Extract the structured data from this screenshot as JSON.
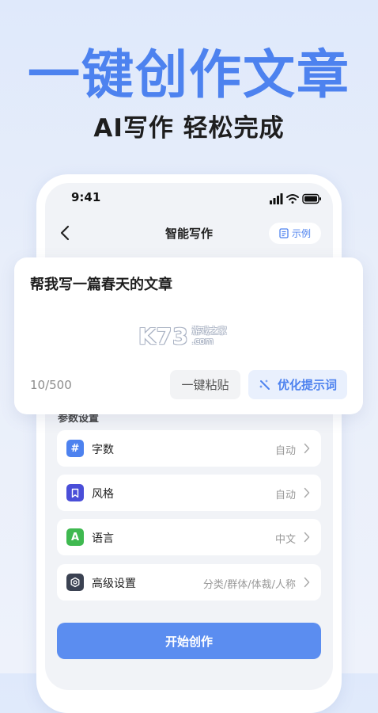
{
  "banner": {
    "headline": "一键创作文章",
    "subline": "AI写作  轻松完成"
  },
  "status_bar": {
    "time": "9:41"
  },
  "nav": {
    "title": "智能写作",
    "example_label": "示例"
  },
  "input": {
    "text": "帮我写一篇春天的文章",
    "counter": "10/500",
    "paste_label": "一键粘贴",
    "optimize_label": "优化提示词"
  },
  "watermark": {
    "big": "K73",
    "small_top": "游戏之家",
    "small_bottom": ".com"
  },
  "params": {
    "section_label": "参数设置",
    "rows": [
      {
        "label": "字数",
        "value": "自动",
        "icon": "hash-icon",
        "color": "#4d82ef"
      },
      {
        "label": "风格",
        "value": "自动",
        "icon": "bookmark-icon",
        "color": "#4a4ed8"
      },
      {
        "label": "语言",
        "value": "中文",
        "icon": "letter-a-icon",
        "color": "#3fb950"
      },
      {
        "label": "高级设置",
        "value": "分类/群体/体裁/人称",
        "icon": "gear-icon",
        "color": "#3b4252"
      }
    ]
  },
  "start_label": "开始创作"
}
